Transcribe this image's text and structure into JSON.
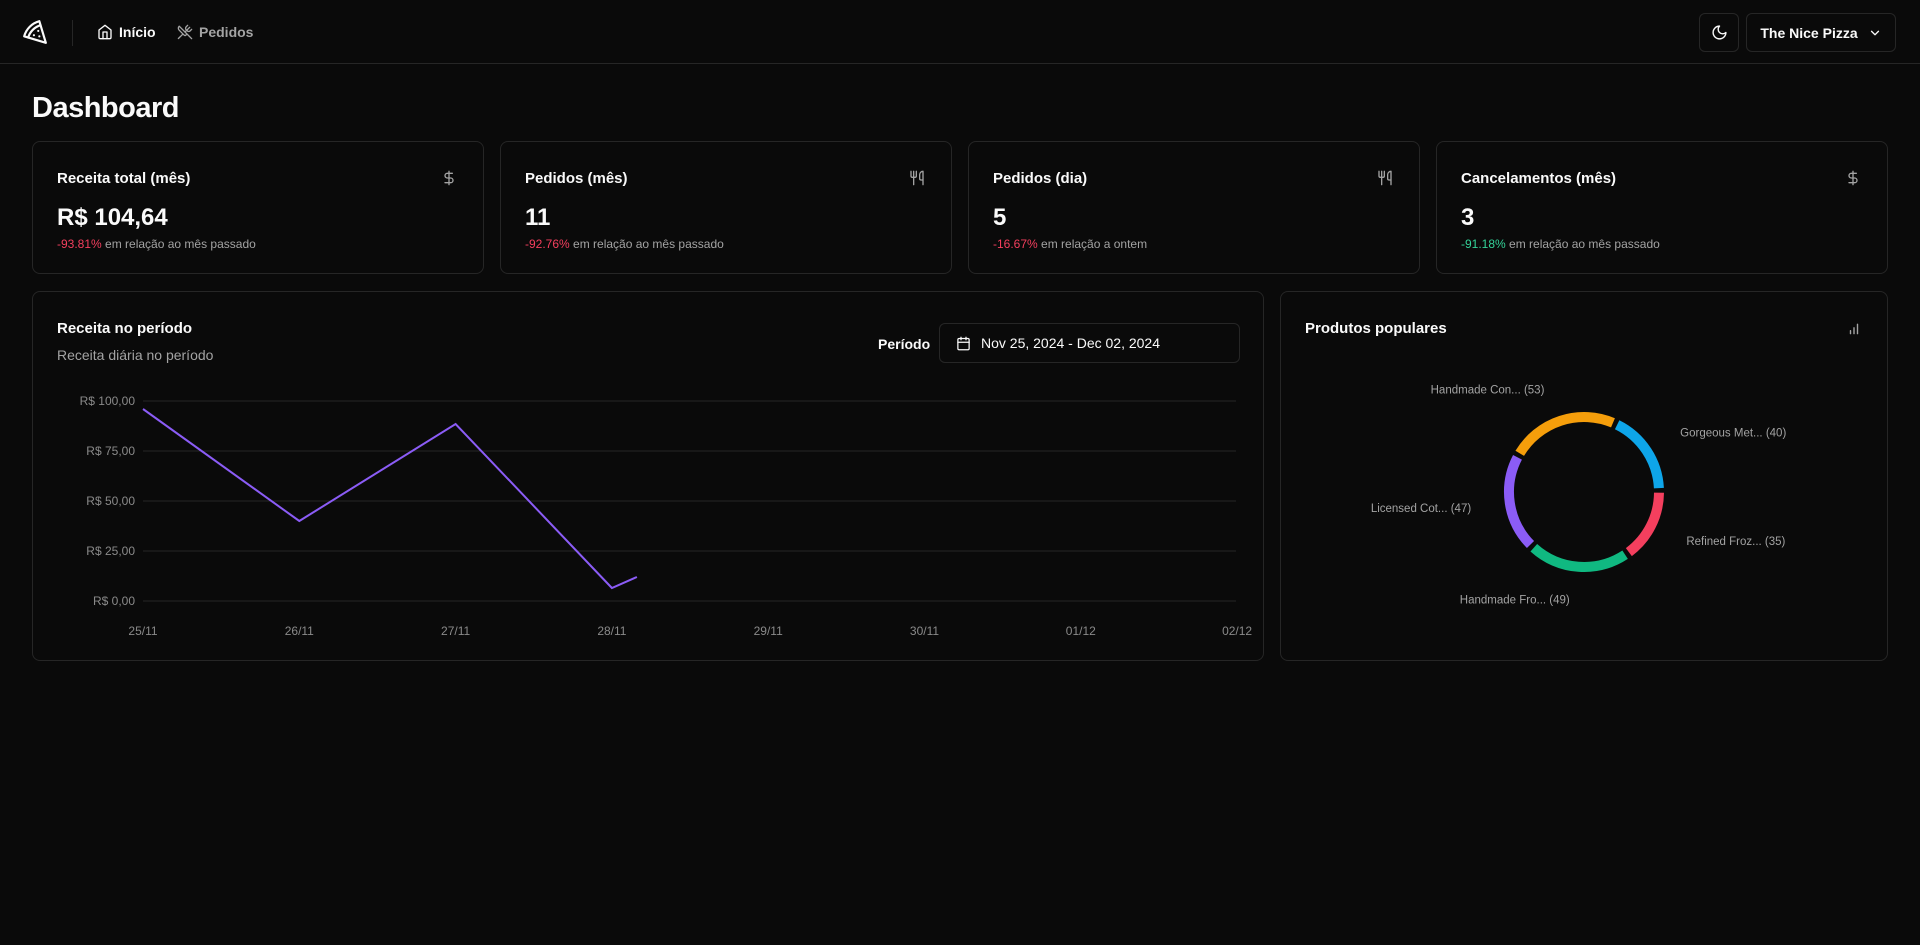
{
  "header": {
    "nav": {
      "home_label": "Início",
      "orders_label": "Pedidos"
    },
    "store_name": "The Nice Pizza",
    "icons": [
      "pizza-logo-icon",
      "home-icon",
      "utensils-crossed-icon",
      "moon-icon",
      "chevron-down-icon"
    ]
  },
  "page": {
    "title": "Dashboard"
  },
  "stats": [
    {
      "title": "Receita total (mês)",
      "value": "R$ 104,64",
      "change": "-93.81%",
      "change_type": "negative",
      "suffix": "em relação ao mês passado",
      "icon": "dollar-sign-icon"
    },
    {
      "title": "Pedidos (mês)",
      "value": "11",
      "change": "-92.76%",
      "change_type": "negative",
      "suffix": "em relação ao mês passado",
      "icon": "utensils-icon"
    },
    {
      "title": "Pedidos (dia)",
      "value": "5",
      "change": "-16.67%",
      "change_type": "negative",
      "suffix": "em relação a ontem",
      "icon": "utensils-icon"
    },
    {
      "title": "Cancelamentos (mês)",
      "value": "3",
      "change": "-91.18%",
      "change_type": "positive",
      "suffix": "em relação ao mês passado",
      "icon": "dollar-sign-icon"
    }
  ],
  "revenue": {
    "title": "Receita no período",
    "description": "Receita diária no período",
    "period_label": "Período",
    "date_range": "Nov 25, 2024 - Dec 02, 2024"
  },
  "popular": {
    "title": "Produtos populares"
  },
  "colors": {
    "line": "#8b5cf6",
    "negative": "#f43f5e",
    "positive": "#34d399"
  },
  "chart_data": [
    {
      "type": "line",
      "title": "Receita no período",
      "x": [
        "25/11",
        "26/11",
        "27/11",
        "28/11",
        "28/11"
      ],
      "categories": [
        "25/11",
        "26/11",
        "27/11",
        "28/11",
        "29/11",
        "30/11",
        "01/12",
        "02/12"
      ],
      "y_values": [
        96,
        40,
        88.5,
        6.5,
        12
      ],
      "x_positions_days": [
        0,
        1,
        2,
        3,
        3.16
      ],
      "yticks": [
        "R$ 0,00",
        "R$ 25,00",
        "R$ 50,00",
        "R$ 75,00",
        "R$ 100,00"
      ],
      "ylim": [
        0,
        100
      ],
      "grid": true,
      "series": [
        {
          "color": "#8b5cf6"
        }
      ]
    },
    {
      "type": "pie",
      "title": "Produtos populares",
      "slices": [
        {
          "label": "Handmade Con...",
          "value": 53,
          "color": "#f59e0b"
        },
        {
          "label": "Gorgeous Met...",
          "value": 40,
          "color": "#0ea5e9"
        },
        {
          "label": "Refined Froz...",
          "value": 35,
          "color": "#f43f5e"
        },
        {
          "label": "Handmade Fro...",
          "value": 49,
          "color": "#10b981"
        },
        {
          "label": "Licensed Cot...",
          "value": 47,
          "color": "#8b5cf6"
        }
      ]
    }
  ]
}
